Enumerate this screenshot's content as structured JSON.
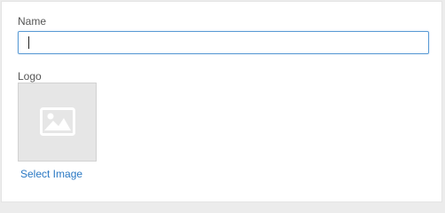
{
  "form": {
    "name_label": "Name",
    "name_value": "",
    "logo_label": "Logo",
    "select_image_label": "Select Image"
  },
  "icons": {
    "logo_placeholder": "image-placeholder-icon"
  },
  "colors": {
    "input_focus_border": "#5b9bd5",
    "link": "#2a78c3",
    "placeholder_bg": "#e6e6e6"
  }
}
